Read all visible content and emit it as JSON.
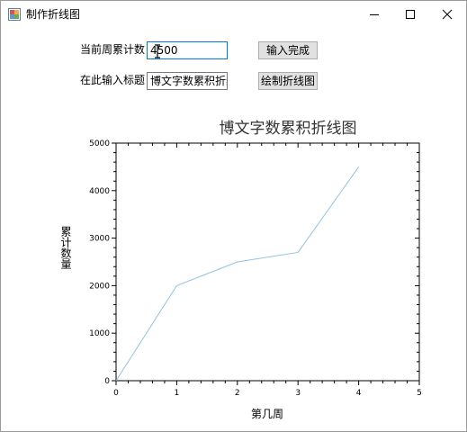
{
  "window": {
    "title": "制作折线图",
    "controls": {
      "minimize_icon": "minimize-icon",
      "maximize_icon": "maximize-icon",
      "close_icon": "close-icon"
    }
  },
  "form": {
    "cumulative_label": "当前周累计数",
    "cumulative_value": "4500",
    "submit_label": "输入完成",
    "title_label": "在此输入标题",
    "title_value": "博文字数累积折线",
    "draw_label": "绘制折线图"
  },
  "chart_data": {
    "type": "line",
    "title": "博文字数累积折线图",
    "xlabel": "第几周",
    "ylabel": "累计数量",
    "x": [
      0,
      1,
      2,
      3,
      4
    ],
    "series": [
      {
        "values": [
          0,
          2000,
          2500,
          2700,
          4500
        ],
        "color": "#8fc3e2"
      }
    ],
    "xlim": [
      0,
      5
    ],
    "ylim": [
      0,
      5000
    ],
    "xticks": [
      "0",
      "1",
      "2",
      "3",
      "4",
      "5"
    ],
    "yticks": [
      "0",
      "1000",
      "2000",
      "3000",
      "4000",
      "5000"
    ],
    "grid": false,
    "legend": "none"
  }
}
